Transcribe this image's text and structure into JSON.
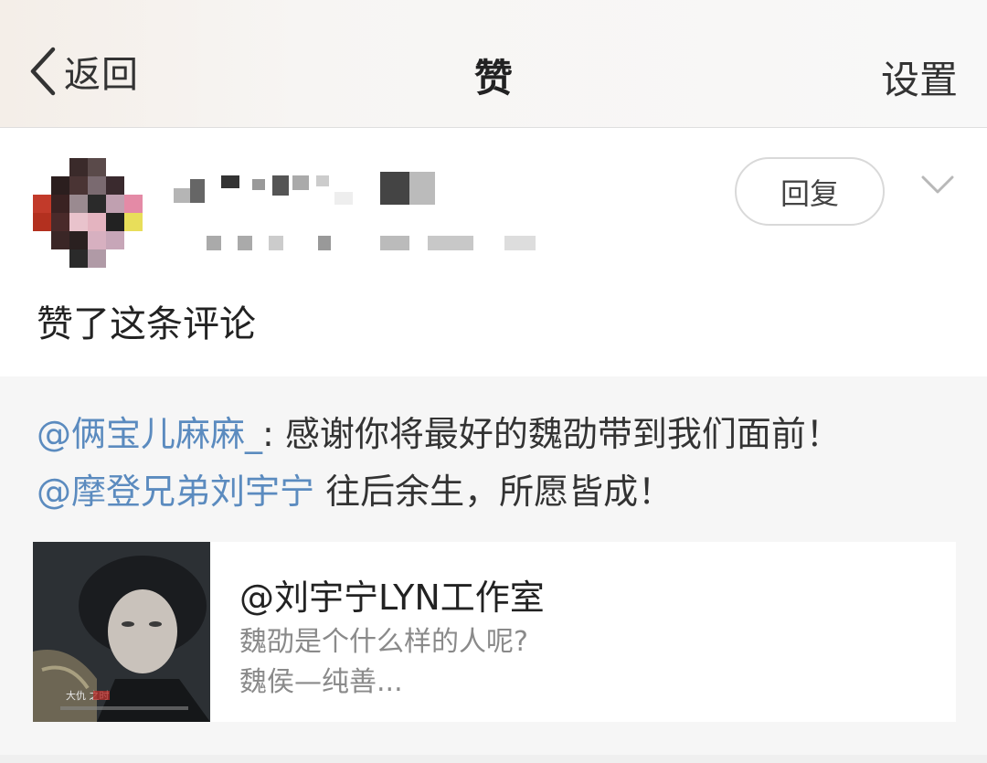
{
  "navbar": {
    "back_label": "返回",
    "title": "赞",
    "settings_label": "设置"
  },
  "notification": {
    "reply_label": "回复",
    "action_text": "赞了这条评论",
    "avatar_icon": "avatar-pixelated",
    "expand_icon": "chevron-down-icon"
  },
  "comment": {
    "line1": {
      "mention": "@俩宝儿麻麻_",
      "text": ": 感谢你将最好的魏劭带到我们面前！"
    },
    "line2": {
      "mention": "@摩登兄弟刘宇宁",
      "text": " 往后余生，所愿皆成！"
    }
  },
  "card": {
    "title": "@刘宇宁LYN工作室",
    "desc_line1": "魏劭是个什么样的人呢?",
    "desc_line2": "魏侯—纯善...",
    "thumb_caption": "大仇    之时"
  },
  "colors": {
    "mention": "#5b8bbf",
    "quote_bg": "#f6f6f6"
  }
}
